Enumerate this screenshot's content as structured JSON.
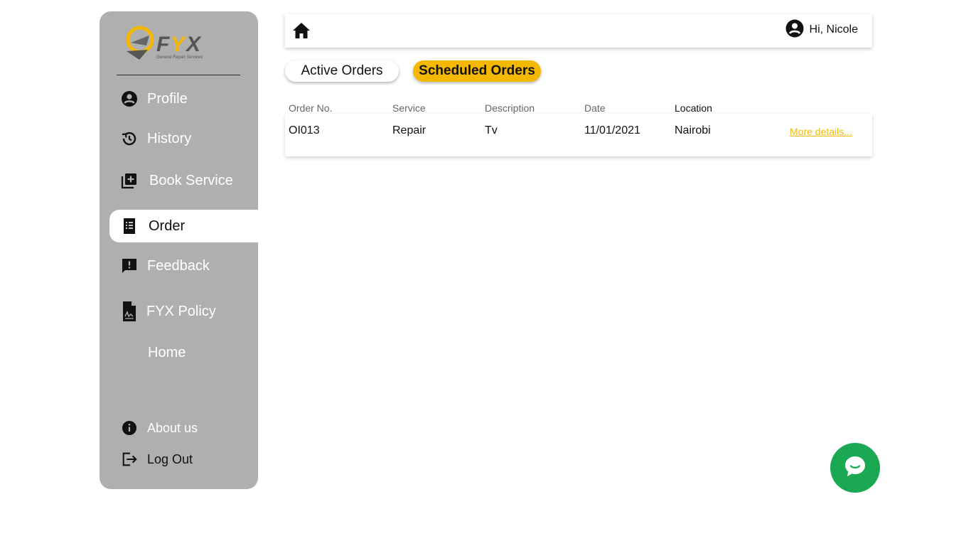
{
  "brand": {
    "logo_text": "FYX",
    "tagline": "General Repair Services"
  },
  "sidebar": {
    "items": [
      {
        "label": "Profile",
        "icon": "account-circle-icon"
      },
      {
        "label": "History",
        "icon": "history-icon"
      },
      {
        "label": "Book Service",
        "icon": "library-add-icon"
      },
      {
        "label": "Order",
        "icon": "receipt-icon",
        "active": true
      },
      {
        "label": "Feedback",
        "icon": "feedback-icon"
      },
      {
        "label": "FYX Policy",
        "icon": "policy-document-icon"
      },
      {
        "label": "Home"
      }
    ],
    "footer": [
      {
        "label": "About us",
        "icon": "info-icon"
      },
      {
        "label": "Log Out",
        "icon": "logout-icon"
      }
    ]
  },
  "topbar": {
    "greeting": "Hi, Nicole"
  },
  "tabs": [
    {
      "label": "Active Orders",
      "selected": false
    },
    {
      "label": "Scheduled Orders",
      "selected": true
    }
  ],
  "table": {
    "headers": [
      "Order No.",
      "Service",
      "Description",
      "Date",
      "Location"
    ],
    "rows": [
      {
        "order_no": "OI013",
        "service": "Repair",
        "description": "Tv",
        "date": "11/01/2021",
        "location": "Nairobi",
        "link": "More details..."
      }
    ]
  },
  "colors": {
    "accent": "#f5b800",
    "sidebar": "#afafaf",
    "chat": "#1aa853"
  }
}
